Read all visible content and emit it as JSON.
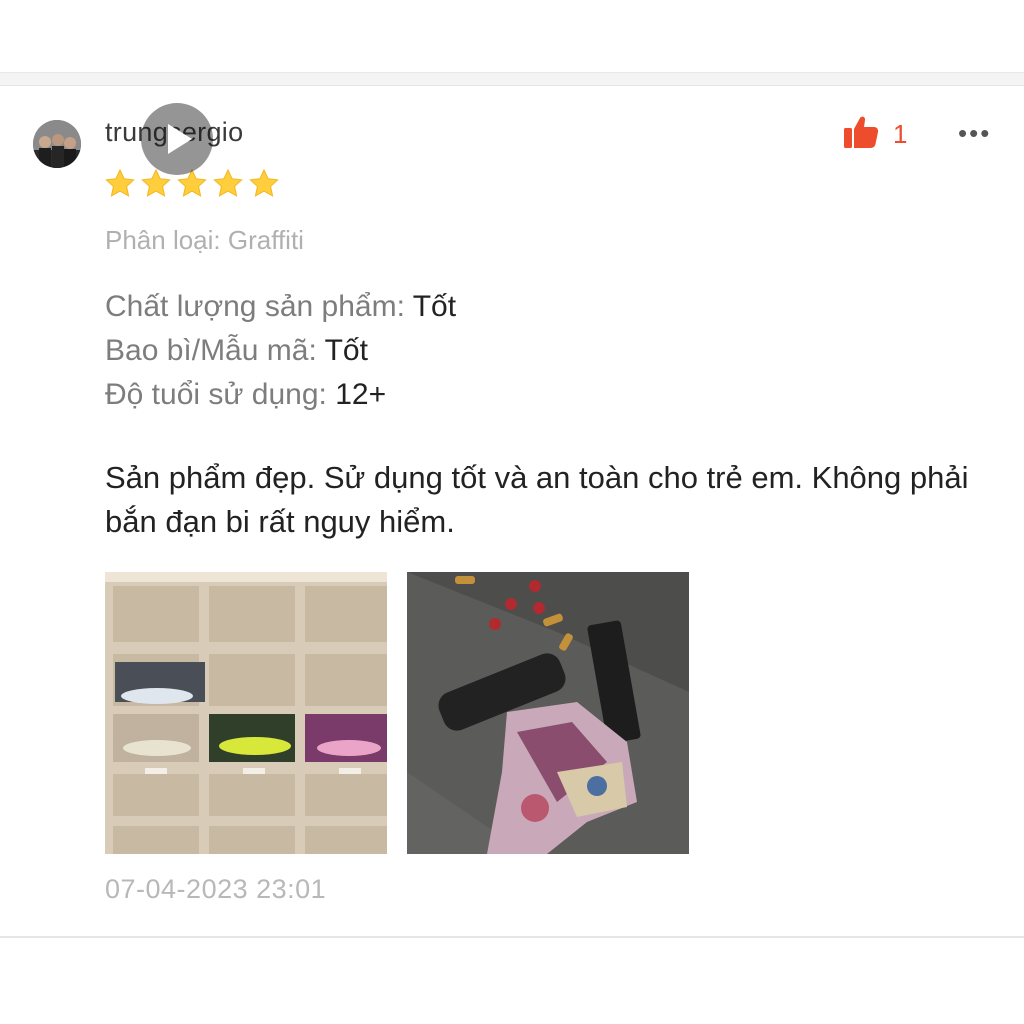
{
  "review": {
    "username": "trungsergio",
    "rating": 5,
    "like_count": "1",
    "more_label": "•••",
    "variation": "Phân loại: Graffiti",
    "attributes": [
      {
        "label": "Chất lượng sản phẩm: ",
        "value": "Tốt"
      },
      {
        "label": "Bao bì/Mẫu mã: ",
        "value": "Tốt"
      },
      {
        "label": "Độ tuổi sử dụng: ",
        "value": "12+"
      }
    ],
    "comment": "Sản phẩm đẹp. Sử dụng tốt và an toàn cho trẻ em. Không phải bắn đạn bi rất nguy hiểm.",
    "media": [
      {
        "type": "video",
        "icon": "play-icon"
      },
      {
        "type": "image"
      }
    ],
    "timestamp": "07-04-2023 23:01"
  },
  "colors": {
    "accent": "#ee4d2d",
    "star": "#ffce3d",
    "muted_text": "#b0b0b0",
    "label_text": "#7d7d7d",
    "body_text": "#222222"
  },
  "icons": {
    "like": "thumbs-up-icon",
    "more": "more-dots-icon",
    "star": "star-icon",
    "play": "play-icon"
  }
}
